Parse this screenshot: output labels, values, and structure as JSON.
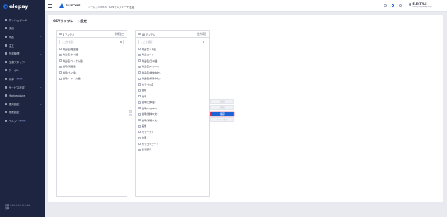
{
  "app": {
    "logo": "elepay"
  },
  "sidebar": {
    "items": [
      {
        "label": "ダッシュボード",
        "chevron": "",
        "badge": ""
      },
      {
        "label": "決済",
        "chevron": "",
        "badge": ""
      },
      {
        "label": "商品",
        "chevron": "⌄",
        "badge": ""
      },
      {
        "label": "注文",
        "chevron": "",
        "badge": ""
      },
      {
        "label": "在庫管理",
        "chevron": "⌄",
        "badge": ""
      },
      {
        "label": "店舗スタッフ",
        "chevron": "",
        "badge": ""
      },
      {
        "label": "クーポン",
        "chevron": "",
        "badge": ""
      },
      {
        "label": "精算",
        "chevron": "",
        "badge": "BETA"
      },
      {
        "label": "サービス設定",
        "chevron": "⌄",
        "badge": ""
      },
      {
        "label": "Marketplace",
        "chevron": "",
        "badge": ""
      },
      {
        "label": "運用設定",
        "chevron": "⌄",
        "badge": ""
      },
      {
        "label": "開発設定",
        "chevron": "",
        "badge": ""
      },
      {
        "label": "ヘルプ",
        "chevron": "",
        "badge": "BETA"
      }
    ],
    "footer": {
      "line1": "環境: ••••••••••••••••",
      "line1_right": "",
      "line2": "日本",
      "line2_right": ""
    }
  },
  "topbar": {
    "company": "ELESTYLE",
    "breadcrumbs": [
      "ホーム",
      "OrderA",
      "CSVテンプレート設定"
    ],
    "user_name": "ELESTYLE",
    "user_email": "elestyle@elestyle.jp"
  },
  "main": {
    "title": "CSVテンプレート設定",
    "left_list": {
      "count": "6 アイテム",
      "selected": "新規注文",
      "search_placeholder": "ここを検索",
      "items": [
        "商品名(韓国語)",
        "商品名(タイ語)",
        "商品名(ベトナム語)",
        "説明(韓国語)",
        "説明(タイ語)",
        "説明(ベトナム語)"
      ]
    },
    "right_list": {
      "count": "18 アイテム",
      "selected": "出力項目",
      "search_placeholder": "ここを検索",
      "items": [
        "商品セット名",
        "商品コード",
        "商品名(日本語)",
        "商品名(English)",
        "商品名(簡体中文)",
        "商品名(繁體中文)",
        "カテゴリ名",
        "価格",
        "税率",
        "説明(日本語)",
        "説明(English)",
        "説明(簡体中文)",
        "説明(繁體中文)",
        "画像",
        "ステータス",
        "在庫",
        "カテゴリコード",
        "表示順序"
      ]
    },
    "actions": {
      "add": "追加",
      "remove": "削除",
      "save": "保存",
      "cancel": "キャンセル"
    }
  }
}
